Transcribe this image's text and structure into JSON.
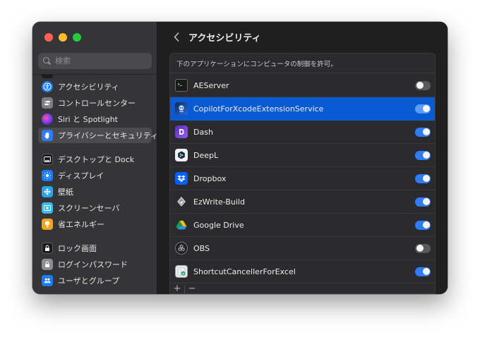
{
  "search": {
    "placeholder": "検索"
  },
  "header": {
    "title": "アクセシビリティ"
  },
  "panel": {
    "description": "下のアプリケーションにコンピュータの制御を許可。"
  },
  "sidebar": {
    "items": [
      {
        "label": "アクセシビリティ",
        "icon": "accessibility-icon",
        "color": "#1a7cf5"
      },
      {
        "label": "コントロールセンター",
        "icon": "control-center-icon",
        "color": "#7d7d82"
      },
      {
        "label": "Siri と Spotlight",
        "icon": "siri-icon",
        "color": "#8a3fd1"
      },
      {
        "label": "プライバシーとセキュリティ",
        "icon": "hand-icon",
        "color": "#2f7cf6",
        "selected": true
      },
      {
        "label": "デスクトップと Dock",
        "icon": "dock-icon",
        "color": "#1c1c1e"
      },
      {
        "label": "ディスプレイ",
        "icon": "display-icon",
        "color": "#1a7cf5"
      },
      {
        "label": "壁紙",
        "icon": "wallpaper-icon",
        "color": "#2aa3e8"
      },
      {
        "label": "スクリーンセーバ",
        "icon": "screensaver-icon",
        "color": "#3db9e8"
      },
      {
        "label": "省エネルギー",
        "icon": "energy-icon",
        "color": "#f3a41b"
      },
      {
        "label": "ロック画面",
        "icon": "lock-screen-icon",
        "color": "#1c1c1e"
      },
      {
        "label": "ログインパスワード",
        "icon": "password-icon",
        "color": "#8e8e93"
      },
      {
        "label": "ユーザとグループ",
        "icon": "users-icon",
        "color": "#1a7cf5"
      }
    ]
  },
  "apps": [
    {
      "name": "AEServer",
      "icon": "terminal-icon",
      "enabled": false
    },
    {
      "name": "CopilotForXcodeExtensionService",
      "icon": "copilot-icon",
      "enabled": true,
      "selected": true
    },
    {
      "name": "Dash",
      "icon": "dash-icon",
      "enabled": true
    },
    {
      "name": "DeepL",
      "icon": "deepl-icon",
      "enabled": true
    },
    {
      "name": "Dropbox",
      "icon": "dropbox-icon",
      "enabled": true
    },
    {
      "name": "EzWrite-Build",
      "icon": "ezwrite-icon",
      "enabled": true
    },
    {
      "name": "Google Drive",
      "icon": "google-drive-icon",
      "enabled": true
    },
    {
      "name": "OBS",
      "icon": "obs-icon",
      "enabled": false
    },
    {
      "name": "ShortcutCancellerForExcel",
      "icon": "shortcut-canceller-icon",
      "enabled": true
    }
  ],
  "footer": {
    "add_label": "+",
    "remove_label": "−"
  }
}
